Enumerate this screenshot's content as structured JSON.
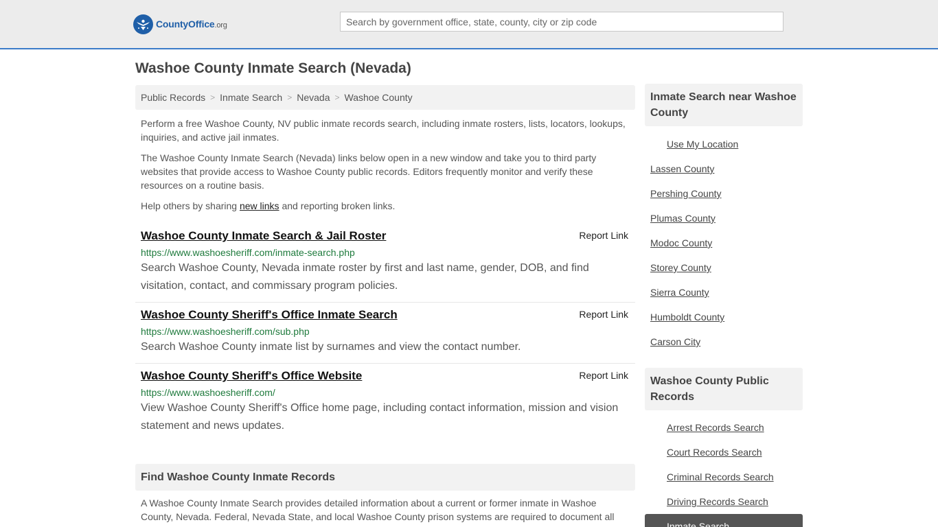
{
  "header": {
    "logo_brand": "CountyOffice",
    "logo_suffix": ".org",
    "search_placeholder": "Search by government office, state, county, city or zip code"
  },
  "page_title": "Washoe County Inmate Search (Nevada)",
  "breadcrumb": [
    {
      "label": "Public Records"
    },
    {
      "label": "Inmate Search"
    },
    {
      "label": "Nevada"
    },
    {
      "label": "Washoe County"
    }
  ],
  "breadcrumb_sep": ">",
  "intro": {
    "p1": "Perform a free Washoe County, NV public inmate records search, including inmate rosters, lists, locators, lookups, inquiries, and active jail inmates.",
    "p2": "The Washoe County Inmate Search (Nevada) links below open in a new window and take you to third party websites that provide access to Washoe County public records. Editors frequently monitor and verify these resources on a routine basis.",
    "p3_before": "Help others by sharing ",
    "p3_link": "new links",
    "p3_after": " and reporting broken links."
  },
  "report_label": "Report Link",
  "links": [
    {
      "title": "Washoe County Inmate Search & Jail Roster",
      "url": "https://www.washoesheriff.com/inmate-search.php",
      "desc": "Search Washoe County, Nevada inmate roster by first and last name, gender, DOB, and find visitation, contact, and commissary program policies."
    },
    {
      "title": "Washoe County Sheriff's Office Inmate Search",
      "url": "https://www.washoesheriff.com/sub.php",
      "desc": "Search Washoe County inmate list by surnames and view the contact number."
    },
    {
      "title": "Washoe County Sheriff's Office Website",
      "url": "https://www.washoesheriff.com/",
      "desc": "View Washoe County Sheriff's Office home page, including contact information, mission and vision statement and news updates."
    }
  ],
  "find": {
    "heading": "Find Washoe County Inmate Records",
    "text": "A Washoe County Inmate Search provides detailed information about a current or former inmate in Washoe County, Nevada. Federal, Nevada State, and local Washoe County prison systems are required to document all"
  },
  "sidebar": {
    "nearby_heading": "Inmate Search near Washoe County",
    "use_location": "Use My Location",
    "nearby": [
      "Lassen County",
      "Pershing County",
      "Plumas County",
      "Modoc County",
      "Storey County",
      "Sierra County",
      "Humboldt County",
      "Carson City"
    ],
    "records_heading": "Washoe County Public Records",
    "records": [
      "Arrest Records Search",
      "Court Records Search",
      "Criminal Records Search",
      "Driving Records Search",
      "Inmate Search"
    ]
  },
  "colors": {
    "brand": "#1f5fa8",
    "url_green": "#1e7a3c",
    "header_border": "#3a7bc8"
  }
}
